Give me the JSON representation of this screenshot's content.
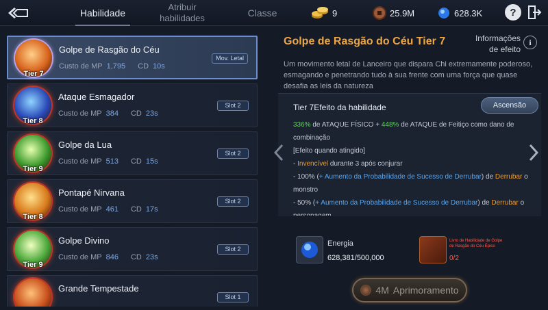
{
  "topbar": {
    "tabs": [
      {
        "label": "Habilidade"
      },
      {
        "label": "Atribuir habilidades"
      },
      {
        "label": "Classe"
      }
    ],
    "currencies": {
      "gold": "9",
      "coin": "25.9M",
      "gem": "628.3K"
    },
    "help_label": "?"
  },
  "skills": [
    {
      "name": "Golpe de Rasgão do Céu",
      "tier": "Tier 7",
      "mp_label": "Custo de MP",
      "mp": "1,795",
      "cd_label": "CD",
      "cd": "10s",
      "badge": "Mov. Letal"
    },
    {
      "name": "Ataque Esmagador",
      "tier": "Tier 8",
      "mp_label": "Custo de MP",
      "mp": "384",
      "cd_label": "CD",
      "cd": "23s",
      "badge": "Slot 2"
    },
    {
      "name": "Golpe da Lua",
      "tier": "Tier 9",
      "mp_label": "Custo de MP",
      "mp": "513",
      "cd_label": "CD",
      "cd": "15s",
      "badge": "Slot 2"
    },
    {
      "name": "Pontapé Nirvana",
      "tier": "Tier 8",
      "mp_label": "Custo de MP",
      "mp": "461",
      "cd_label": "CD",
      "cd": "17s",
      "badge": "Slot 2"
    },
    {
      "name": "Golpe Divino",
      "tier": "Tier 9",
      "mp_label": "Custo de MP",
      "mp": "846",
      "cd_label": "CD",
      "cd": "23s",
      "badge": "Slot 2"
    },
    {
      "name": "Grande Tempestade",
      "tier": "",
      "mp_label": "",
      "mp": "",
      "cd_label": "",
      "cd": "",
      "badge": "Slot 1"
    }
  ],
  "detail": {
    "title": "Golpe de Rasgão do Céu Tier 7",
    "info_label": "Informações de efeito",
    "info_icon": "i",
    "description": "Um movimento letal de Lanceiro que dispara Chi extremamente poderoso, esmagando e penetrando tudo à sua frente com uma força que quase desafia as leis da natureza",
    "effect_title": "Tier 7Efeito da habilidade",
    "ascend_label": "Ascensão",
    "effect": {
      "pct1": "336%",
      "text1": " de ATAQUE FÍSICO + ",
      "pct2": "448%",
      "text2": " de ATAQUE de Feitiço como dano de combinação",
      "on_hit": "[Efeito quando atingido]",
      "inv_prefix": "- ",
      "inv_word": "Invencível",
      "inv_suffix": " durante 3 após conjurar",
      "l3_prefix": "- 100% (",
      "l3_blue": "+ Aumento da Probabilidade de Sucesso de Derrubar",
      "l3_mid": ") de ",
      "l3_orange": "Derrubar",
      "l3_suffix": " o monstro",
      "l4_prefix": "- 50% (",
      "l4_blue": "+ Aumento da Probabilidade de Sucesso de Derrubar",
      "l4_mid": ") de ",
      "l4_orange": "Derrubar",
      "l4_suffix": " o personagem"
    },
    "energy_label": "Energia",
    "energy_value": "628,381/500,000",
    "book_label": "Livro de Habilidade de Golpe de Rasgão do Céu Épico",
    "book_count": "0/2",
    "upgrade_cost": "4M",
    "upgrade_label": "Aprimoramento"
  },
  "colors": {
    "title_orange": "#f0a640",
    "green": "#5fd35a",
    "orange": "#ec9a2c",
    "blue": "#5ba4ea",
    "red": "#ff5a4a"
  }
}
